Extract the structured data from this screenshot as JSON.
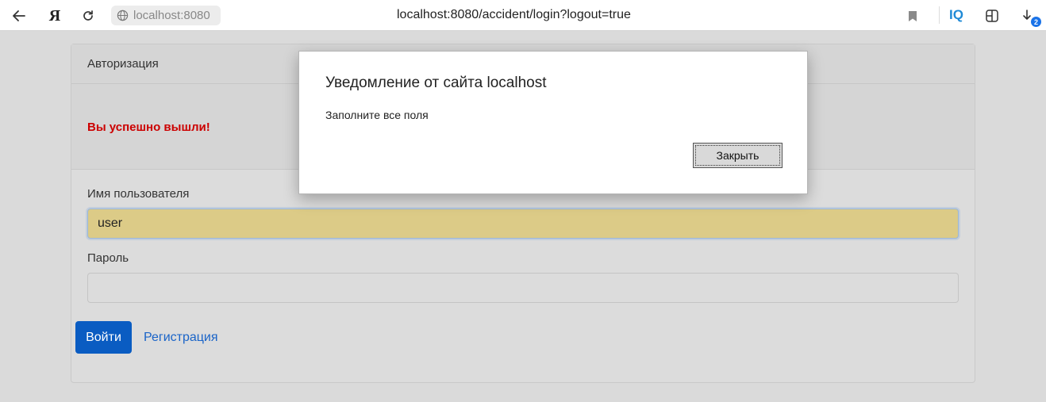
{
  "browser": {
    "site_chip": "localhost:8080",
    "url": "localhost:8080/accident/login?logout=true",
    "iq_label": "IQ",
    "yandex_label": "Я",
    "downloads_count": "2",
    "icons": [
      "back-arrow-icon",
      "yandex-icon",
      "reload-icon",
      "globe-icon",
      "bookmark-icon",
      "iq-icon",
      "extensions-icon",
      "downloads-icon"
    ]
  },
  "card": {
    "header": "Авторизация",
    "alert": "Вы успешно вышли!",
    "username_label": "Имя пользователя",
    "username_value": "user",
    "password_label": "Пароль",
    "password_value": "",
    "login_button": "Войти",
    "register_link": "Регистрация"
  },
  "dialog": {
    "title": "Уведомление от сайта localhost",
    "message": "Заполните все поля",
    "close_button": "Закрыть"
  },
  "colors": {
    "alert": "#cc0000",
    "primary_button": "#0a5cc2",
    "link": "#1a64c8",
    "autofill": "#dccb87"
  }
}
